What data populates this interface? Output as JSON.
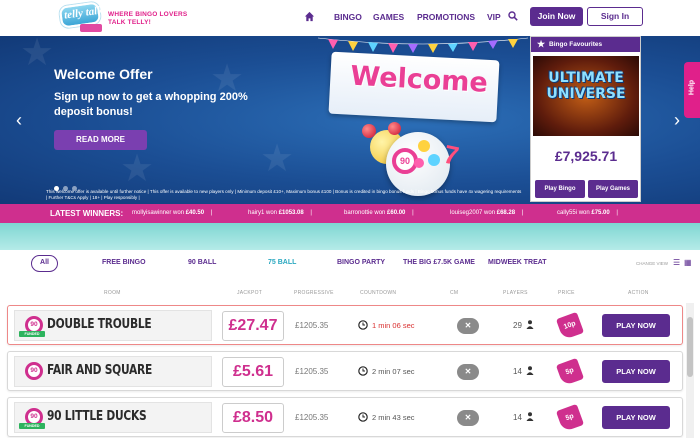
{
  "header": {
    "logo_text": "telly talk",
    "tagline": "WHERE BINGO LOVERS TALK TELLY!",
    "nav": [
      "BINGO",
      "GAMES",
      "PROMOTIONS",
      "VIP"
    ],
    "join_label": "Join Now",
    "signin_label": "Sign In"
  },
  "hero": {
    "title": "Welcome Offer",
    "subtitle": "Sign up now to get a whopping 200% deposit bonus!",
    "cta": "READ MORE",
    "art_word": "Welcome",
    "ball_number": "90",
    "disclaimer": "This welcome offer is available until further notice | This offer is available to new players only | Minimum deposit £10+, Maximum bonus £100 | Bonus is credited in bingo bonus funds | Bingo bonus funds have 4x wagering requirements | Further T&Cs Apply | 18+ | Play responsibly |",
    "prev_arrow": "‹",
    "next_arrow": "›",
    "slides": 3,
    "active_slide": 1
  },
  "favourites": {
    "title": "Bingo Favourites",
    "game_title": "ULTIMATE UNIVERSE",
    "jackpot": "£7,925.71",
    "play_bingo": "Play Bingo",
    "play_games": "Play Games"
  },
  "help_label": "Help",
  "winners": {
    "label": "LATEST WINNERS:",
    "items": [
      {
        "user": "mollyisawinner",
        "won": "won",
        "amount": "£40.50"
      },
      {
        "user": "hairy1",
        "won": "won",
        "amount": "£1053.08"
      },
      {
        "user": "barronottie",
        "won": "won",
        "amount": "£60.00"
      },
      {
        "user": "louiseg2007",
        "won": "won",
        "amount": "£68.28"
      },
      {
        "user": "cally55i",
        "won": "won",
        "amount": "£75.00"
      }
    ]
  },
  "filters": {
    "all": "All",
    "items": [
      "FREE BINGO",
      "90 BALL",
      "75 BALL",
      "BINGO PARTY",
      "THE BIG £7.5K GAME",
      "MIDWEEK TREAT"
    ],
    "active": "75 BALL",
    "change_view": "CHANGE VIEW"
  },
  "table": {
    "columns": [
      "ROOM",
      "JACKPOT",
      "PROGRESSIVE",
      "COUNTDOWN",
      "CM",
      "PLAYERS",
      "PRICE",
      "ACTION"
    ],
    "rows": [
      {
        "ball": "90",
        "tag": "FUNDED",
        "name": "DOUBLE TROUBLE",
        "jackpot": "£27.47",
        "progressive": "£1205.35",
        "countdown": "1 min 06 sec",
        "urgent": true,
        "cm": "✕",
        "players": "29",
        "price": "10p",
        "action": "PLAY NOW"
      },
      {
        "ball": "90",
        "tag": "",
        "name": "FAIR AND SQUARE",
        "jackpot": "£5.61",
        "progressive": "£1205.35",
        "countdown": "2 min 07 sec",
        "urgent": false,
        "cm": "✕",
        "players": "14",
        "price": "5p",
        "action": "PLAY NOW"
      },
      {
        "ball": "90",
        "tag": "FUNDED",
        "name": "90 LITTLE DUCKS",
        "jackpot": "£8.50",
        "progressive": "£1205.35",
        "countdown": "2 min 43 sec",
        "urgent": false,
        "cm": "✕",
        "players": "14",
        "price": "5p",
        "action": "PLAY NOW"
      }
    ]
  },
  "colors": {
    "brand_purple": "#5b2c8f",
    "brand_pink": "#cf2f8e",
    "hero_blue": "#1b4e94",
    "teal": "#7fd6d2",
    "active_filter": "#2aa8c0"
  }
}
